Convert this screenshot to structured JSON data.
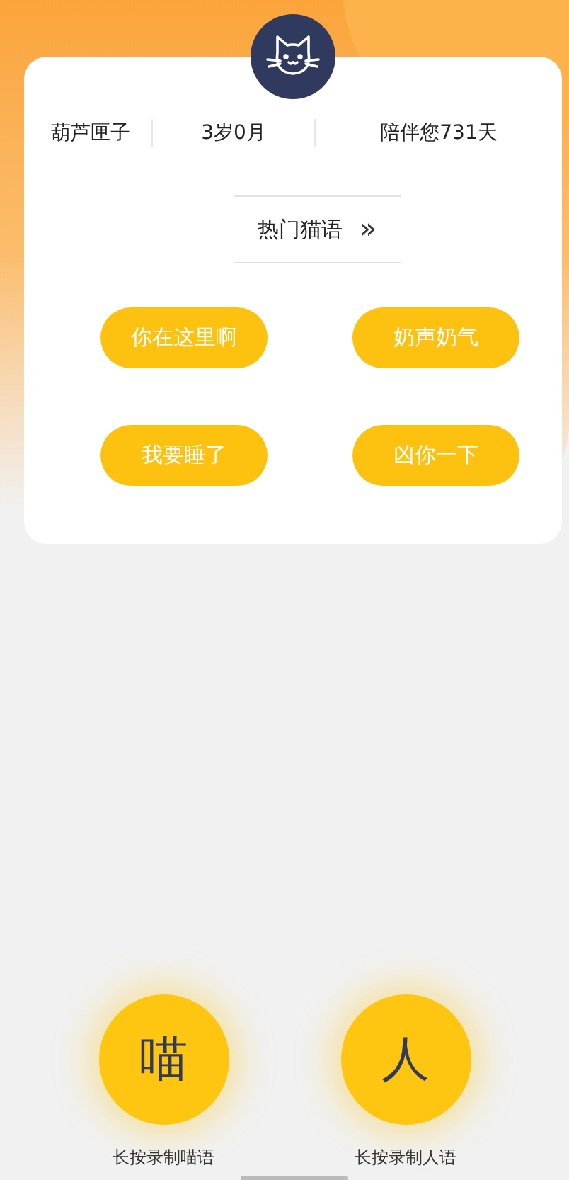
{
  "profile": {
    "name": "葫芦匣子",
    "age": "3岁0月",
    "days": "陪伴您731天"
  },
  "hot_phrases": {
    "title": "热门猫语",
    "more": "»",
    "phrases": [
      "你在这里啊",
      "奶声奶气",
      "我要睡了",
      "凶你一下"
    ]
  },
  "record_buttons": [
    {
      "glyph": "喵",
      "label": "长按录制喵语"
    },
    {
      "glyph": "人",
      "label": "长按录制人语"
    }
  ]
}
